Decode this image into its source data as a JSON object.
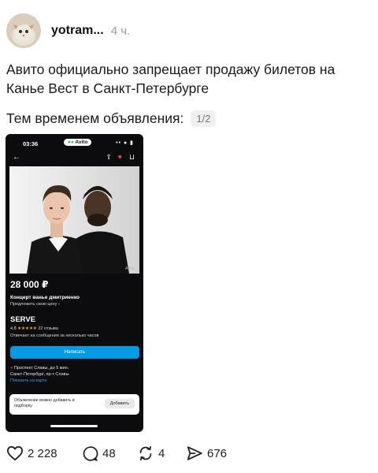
{
  "post": {
    "username": "yotram...",
    "time": "4 ч.",
    "text": "Авито официально запрещает продажу билетов на Канье Вест в Санкт-Петербурге",
    "subtext": "Тем временем объявления:",
    "media_counter": "1/2"
  },
  "phone": {
    "status_time": "03:36",
    "app_pill": "Avito",
    "status_icons": "•• ● ▮"
  },
  "listing": {
    "price": "28 000 ₽",
    "title": "Концерт ванье дмитриенко",
    "offer_link": "Предложить свою цену ›",
    "seller_name": "SERVE",
    "rating_value": "4,8",
    "rating_stars": "★★★★★",
    "rating_count": "22 отзыва",
    "reply_time": "Отвечает на сообщения за несколько часов",
    "write_button": "Написать",
    "metro": "Проспект Славы, до 5 мин.",
    "street": "Санкт-Петербург, пр-т Славы",
    "map_link": "Показать на карте",
    "watermark": "Avito"
  },
  "toast": {
    "text": "Объявление можно добавить в подборку",
    "button": "Добавить"
  },
  "actions": {
    "likes": "2 228",
    "comments": "48",
    "reposts": "4",
    "shares": "676"
  },
  "icons": {
    "like": "heart-outline-icon",
    "comment": "comment-bubble-icon",
    "repost": "repost-arrows-icon",
    "share": "share-arrow-icon"
  },
  "colors": {
    "blue_button": "#049be5",
    "link_blue": "#37a0f0",
    "heart_red": "#ff3b50",
    "phone_bg": "#0c0c0e",
    "meta_gray": "#9a9a9a"
  }
}
